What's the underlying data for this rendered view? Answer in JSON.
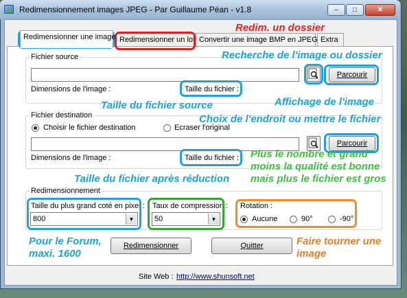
{
  "window": {
    "title": "Redimensionnement images JPEG - Par Guillaume Péan - v1.8",
    "minimize": "–",
    "maximize": "□",
    "close": "✕"
  },
  "tabs": [
    {
      "label": "Redimensionner une image",
      "active": true
    },
    {
      "label": "Redimensionner un lot",
      "active": false
    },
    {
      "label": "Convertir une image BMP en JPEG",
      "active": false
    },
    {
      "label": "Extra",
      "active": false
    }
  ],
  "source": {
    "legend": "Fichier source",
    "path_value": "",
    "dims_label": "Dimensions de l'image :",
    "size_label": "Taille du fichier :",
    "browse_button": "Parcourir",
    "preview_icon": "magnifier-icon"
  },
  "destination": {
    "legend": "Fichier destination",
    "choose_option": "Choisir le fichier destination",
    "overwrite_option": "Ecraser l'original",
    "selected": "choose",
    "path_value": "",
    "dims_label": "Dimensions de l'image :",
    "size_label": "Taille du fichier :",
    "browse_button": "Parcourir",
    "preview_icon": "magnifier-icon"
  },
  "resize": {
    "legend": "Redimensionnement",
    "max_side_label": "Taille du plus grand coté en pixel :",
    "max_side_value": "800",
    "compression_label": "Taux de compression :",
    "compression_value": "50",
    "rotation_label": "Rotation :",
    "rotation_options": [
      "Aucune",
      "90°",
      "-90°"
    ],
    "rotation_selected": "Aucune",
    "resize_button": "Redimensionner",
    "quit_button": "Quitter"
  },
  "footer": {
    "site_label": "Site Web :",
    "site_url": "http://www.shunsoft.net"
  },
  "annotations": {
    "redim_dossier": "Redim. un dossier",
    "recherche": "Recherche de l'image ou dossier",
    "taille_source": "Taille du fichier source",
    "affichage": "Affichage de l'image",
    "choix_endroit": "Choix de l'endroit ou mettre le fichier",
    "taille_apres": "Taille du fichier après réduction",
    "qualite_1": "Plus le nombre et grand",
    "qualite_2": "moins la qualité est bonne",
    "qualite_3": "mais plus le fichier est gros",
    "forum_1": "Pour le Forum,",
    "forum_2": "maxi. 1600",
    "tourner_1": "Faire tourner une",
    "tourner_2": "image"
  },
  "colors": {
    "annotation_blue": "#1aa3dc",
    "annotation_red": "#e8231f",
    "annotation_green": "#3ec23e",
    "annotation_orange": "#f07a20"
  }
}
